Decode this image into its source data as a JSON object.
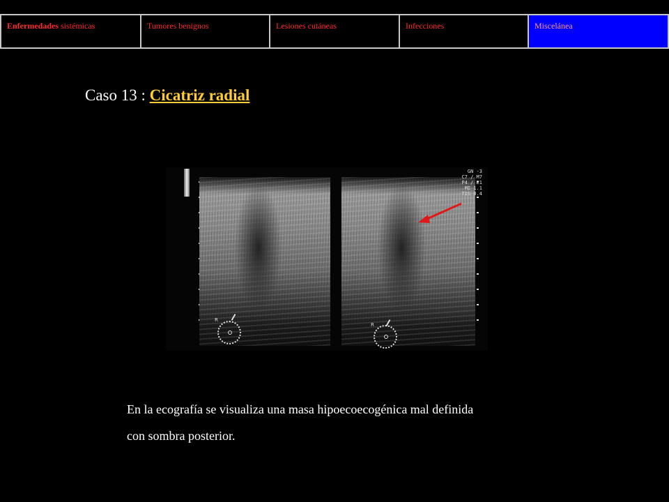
{
  "nav": {
    "items": [
      {
        "bold": "Enfermedades",
        "rest": " sistémicas"
      },
      {
        "bold": "",
        "rest": "Tumores benignos"
      },
      {
        "bold": "",
        "rest": "Lesiones cutáneas"
      },
      {
        "bold": "",
        "rest": "Infecciones"
      },
      {
        "bold": "",
        "rest": "Miscelánea"
      }
    ],
    "active_index": 4
  },
  "case": {
    "prefix": "Caso 13 : ",
    "link_text": "Cicatriz radial"
  },
  "scan": {
    "params": [
      "GN -3",
      "C7 / M7",
      "P4 / E1",
      "MI 1.1",
      "TIS 0.4"
    ],
    "orientation_label": "R"
  },
  "caption": {
    "line1": "En la ecografía se visualiza una masa hipoecoecogénica mal definida",
    "line2": "con sombra posterior."
  },
  "colors": {
    "background": "#000000",
    "nav_text": "#ff2a2a",
    "nav_active_bg": "#0000ff",
    "link": "#ffcc33",
    "arrow": "#e01818"
  }
}
